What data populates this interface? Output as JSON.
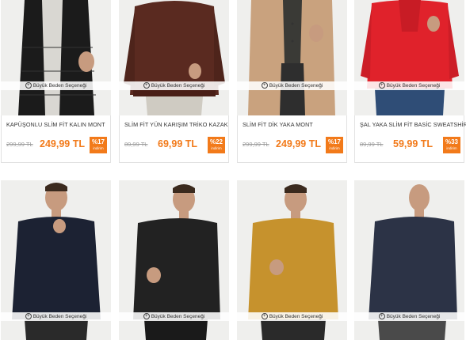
{
  "colors": {
    "accent": "#f27a1a",
    "border": "#e2e2e2",
    "old_price": "#999999"
  },
  "size_selector_label": "Büyük Beden Seçeneği",
  "badge_sub_label": "indirim",
  "products_row1": [
    {
      "name": "KAPÜŞONLU SLİM FİT KALIN MONT",
      "old_price": "299,99 TL",
      "price": "249,99 TL",
      "discount": "%17",
      "garment": "black puffer jacket",
      "garment_color": "#1b1b1b"
    },
    {
      "name": "SLİM FİT YÜN KARIŞIM TRİKO KAZAK",
      "old_price": "89,99 TL",
      "price": "69,99 TL",
      "discount": "%22",
      "garment": "brown knit sweater",
      "garment_color": "#5a2a20"
    },
    {
      "name": "SLİM FİT DİK YAKA MONT",
      "old_price": "299,99 TL",
      "price": "249,99 TL",
      "discount": "%17",
      "garment": "camel coat",
      "garment_color": "#c9a27e"
    },
    {
      "name": "ŞAL YAKA SLİM FİT BASİC SWEATSHİRT",
      "old_price": "89,99 TL",
      "price": "59,99 TL",
      "discount": "%33",
      "garment": "red shawl-collar sweatshirt",
      "garment_color": "#e0222b"
    }
  ],
  "products_row2": [
    {
      "garment": "navy sweater",
      "garment_color": "#1c2233"
    },
    {
      "garment": "black sweater",
      "garment_color": "#222222"
    },
    {
      "garment": "mustard sweater",
      "garment_color": "#c6922d"
    },
    {
      "garment": "navy textured sweater",
      "garment_color": "#2c3346"
    }
  ]
}
